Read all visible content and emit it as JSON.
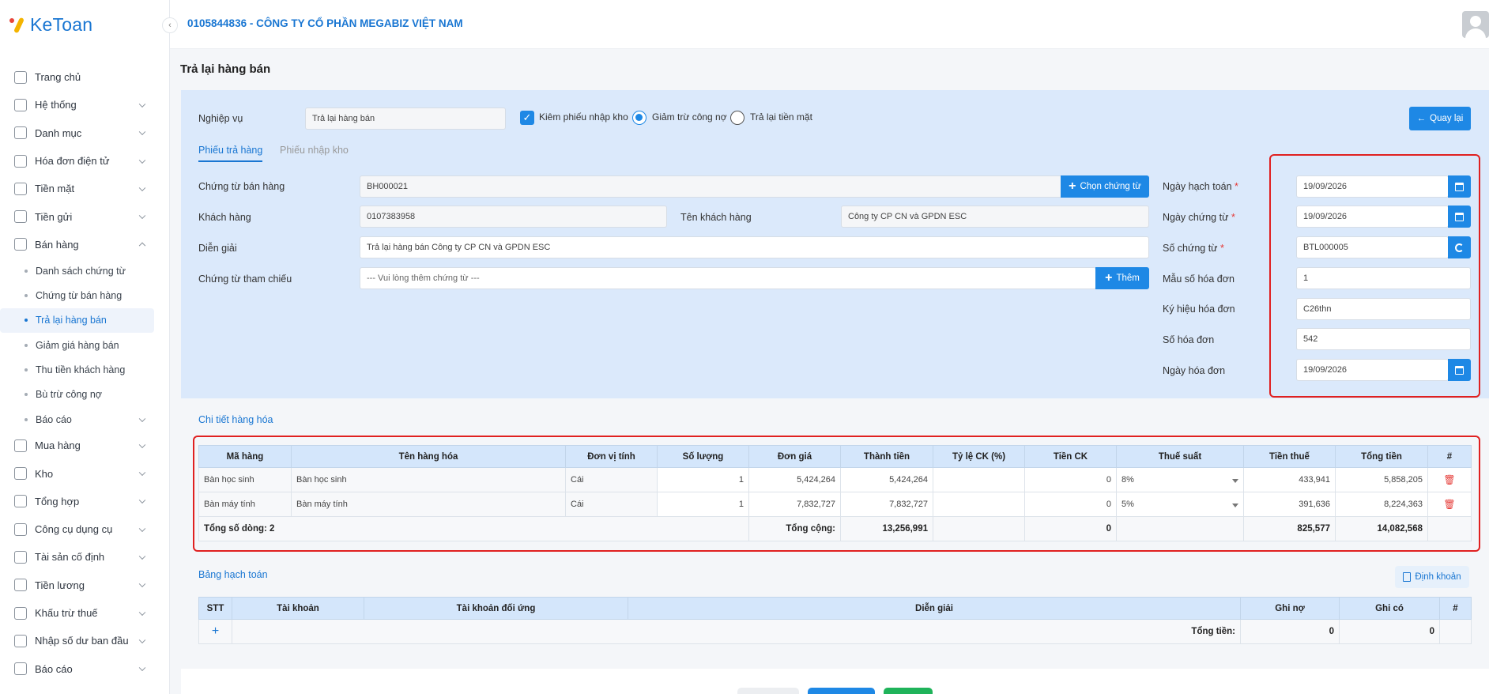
{
  "app": {
    "logo_text": "KeToan",
    "company": "0105844836 - CÔNG TY CỔ PHẦN MEGABIZ VIỆT NAM"
  },
  "sidebar": {
    "items": [
      {
        "label": "Trang chủ",
        "icon": "home-icon",
        "expandable": false
      },
      {
        "label": "Hệ thống",
        "icon": "gear-icon",
        "expandable": true
      },
      {
        "label": "Danh mục",
        "icon": "grid-icon",
        "expandable": true
      },
      {
        "label": "Hóa đơn điện tử",
        "icon": "invoice-icon",
        "expandable": true
      },
      {
        "label": "Tiền mặt",
        "icon": "cash-icon",
        "expandable": true
      },
      {
        "label": "Tiền gửi",
        "icon": "bank-icon",
        "expandable": true
      },
      {
        "label": "Bán hàng",
        "icon": "sales-icon",
        "expandable": true,
        "expanded": true
      }
    ],
    "sub_items": [
      {
        "label": "Danh sách chứng từ"
      },
      {
        "label": "Chứng từ bán hàng"
      },
      {
        "label": "Trả lại hàng bán",
        "active": true
      },
      {
        "label": "Giảm giá hàng bán"
      },
      {
        "label": "Thu tiền khách hàng"
      },
      {
        "label": "Bù trừ công nợ"
      },
      {
        "label": "Báo cáo",
        "expandable": true
      }
    ],
    "items_after": [
      {
        "label": "Mua hàng",
        "icon": "cart-icon"
      },
      {
        "label": "Kho",
        "icon": "warehouse-icon"
      },
      {
        "label": "Tổng hợp",
        "icon": "chart-icon"
      },
      {
        "label": "Công cụ dụng cụ",
        "icon": "tools-icon"
      },
      {
        "label": "Tài sản cố định",
        "icon": "car-icon"
      },
      {
        "label": "Tiền lương",
        "icon": "salary-icon"
      },
      {
        "label": "Khấu trừ thuế",
        "icon": "tax-icon"
      },
      {
        "label": "Nhập số dư ban đầu",
        "icon": "import-icon"
      },
      {
        "label": "Báo cáo",
        "icon": "report-icon"
      }
    ]
  },
  "page": {
    "title": "Trả lại hàng bán"
  },
  "form": {
    "nghiep_vu_label": "Nghiệp vụ",
    "nghiep_vu_value": "Trả lại hàng bán",
    "kiem_phieu_label": "Kiêm phiếu nhập kho",
    "giam_tru_label": "Giảm trừ công nợ",
    "tra_lai_tien_label": "Trả lại tiền mặt",
    "back_button": "Quay lại",
    "tabs": [
      "Phiếu trả hàng",
      "Phiếu nhập kho"
    ],
    "chung_tu_ban_hang_label": "Chứng từ bán hàng",
    "chung_tu_ban_hang_value": "BH000021",
    "chon_chung_tu_button": "Chọn chứng từ",
    "khach_hang_label": "Khách hàng",
    "khach_hang_value": "0107383958",
    "ten_khach_hang_label": "Tên khách hàng",
    "ten_khach_hang_value": "Công ty CP CN và GPDN ESC",
    "dien_giai_label": "Diễn giải",
    "dien_giai_value": "Trả lại hàng bán Công ty CP CN và GPDN ESC",
    "tham_chieu_label": "Chứng từ tham chiếu",
    "tham_chieu_placeholder": "--- Vui lòng thêm chứng từ ---",
    "them_button": "Thêm",
    "ngay_hach_toan_label": "Ngày hạch toán",
    "ngay_hach_toan_value": "19/09/2026",
    "ngay_chung_tu_label": "Ngày chứng từ",
    "ngay_chung_tu_value": "19/09/2026",
    "so_chung_tu_label": "Số chứng từ",
    "so_chung_tu_value": "BTL000005",
    "mau_so_label": "Mẫu số hóa đơn",
    "mau_so_value": "1",
    "ky_hieu_label": "Ký hiệu hóa đơn",
    "ky_hieu_value": "C26thn",
    "so_hoa_don_label": "Số hóa đơn",
    "so_hoa_don_value": "542",
    "ngay_hoa_don_label": "Ngày hóa đơn",
    "ngay_hoa_don_value": "19/09/2026",
    "required_mark": "*"
  },
  "goods": {
    "title": "Chi tiết hàng hóa",
    "columns": [
      "Mã hàng",
      "Tên hàng hóa",
      "Đơn vị tính",
      "Số lượng",
      "Đơn giá",
      "Thành tiền",
      "Tỷ lệ CK (%)",
      "Tiền CK",
      "Thuế suất",
      "Tiền thuế",
      "Tổng tiền",
      "#"
    ],
    "rows": [
      {
        "ma": "Bàn học sinh",
        "ten": "Bàn học sinh",
        "dvt": "Cái",
        "sl": "1",
        "don_gia": "5,424,264",
        "thanh_tien": "5,424,264",
        "tl_ck": "",
        "tien_ck": "0",
        "thue_suat": "8%",
        "tien_thue": "433,941",
        "tong": "5,858,205"
      },
      {
        "ma": "Bàn máy tính",
        "ten": "Bàn máy tính",
        "dvt": "Cái",
        "sl": "1",
        "don_gia": "7,832,727",
        "thanh_tien": "7,832,727",
        "tl_ck": "",
        "tien_ck": "0",
        "thue_suat": "5%",
        "tien_thue": "391,636",
        "tong": "8,224,363"
      }
    ],
    "footer": {
      "count_label": "Tổng số dòng: 2",
      "total_label": "Tổng cộng:",
      "thanh_tien": "13,256,991",
      "tien_ck": "0",
      "tien_thue": "825,577",
      "tong": "14,082,568"
    }
  },
  "accounting": {
    "title": "Bảng hạch toán",
    "dinh_khoan_button": "Định khoản",
    "columns": [
      "STT",
      "Tài khoản",
      "Tài khoản đối ứng",
      "Diễn giải",
      "Ghi nợ",
      "Ghi có",
      "#"
    ],
    "add_symbol": "+",
    "total_label": "Tổng tiền:",
    "ghi_no": "0",
    "ghi_co": "0"
  }
}
